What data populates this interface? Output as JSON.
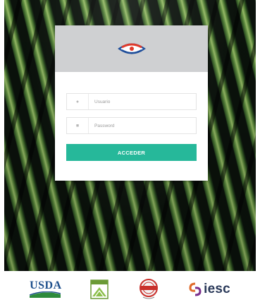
{
  "login": {
    "username_placeholder": "Usuario",
    "password_placeholder": "Password",
    "submit_label": "ACCEDER"
  },
  "footer": {
    "partners": [
      {
        "name": "USDA"
      },
      {
        "name": "iesc"
      }
    ]
  },
  "colors": {
    "button": "#26b89a",
    "header": "#cfd0d2",
    "usda_blue": "#1d4f8c",
    "usda_green": "#2e8b3c",
    "iesc_text": "#2b3a5a"
  },
  "icons": [
    "user-icon",
    "lock-icon"
  ]
}
